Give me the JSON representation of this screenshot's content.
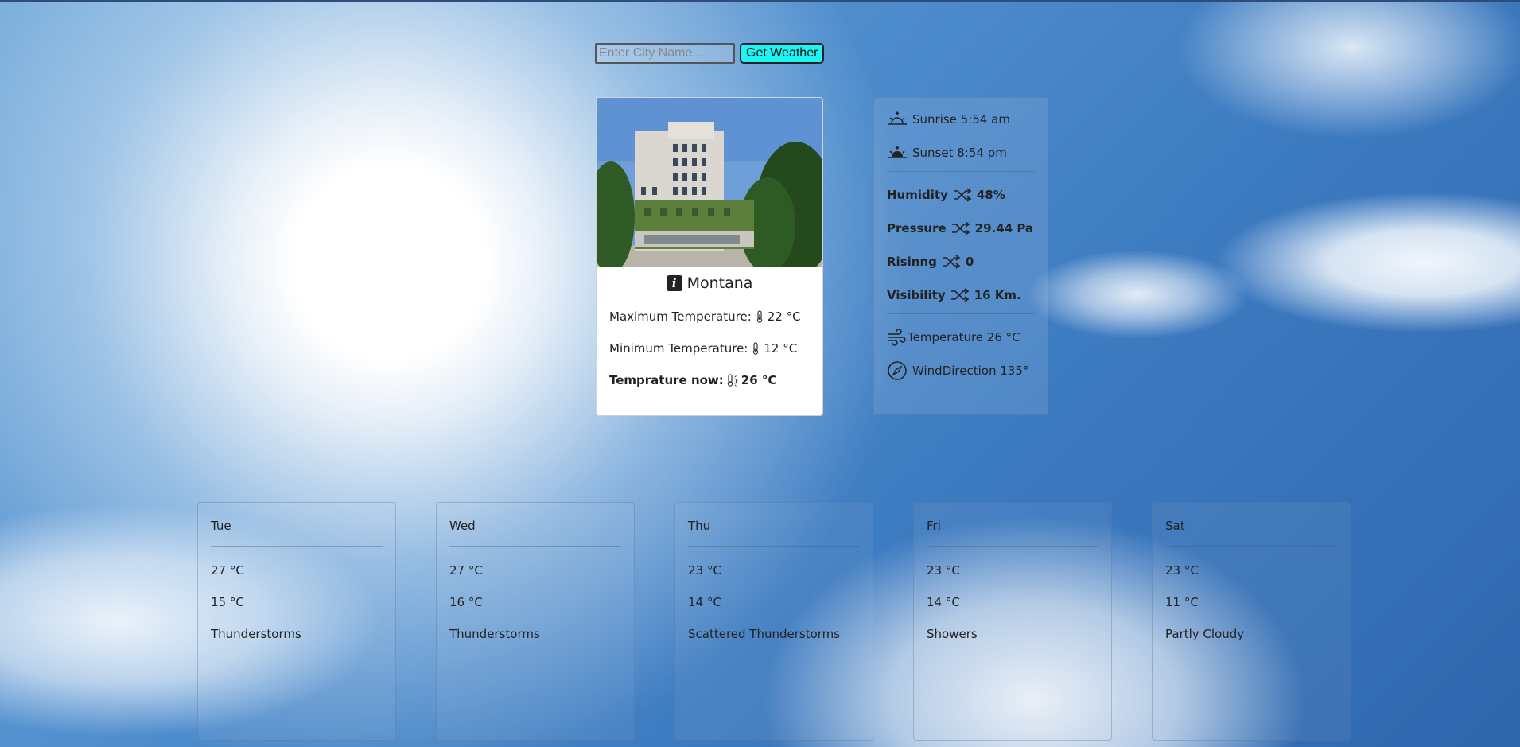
{
  "search": {
    "placeholder": "Enter City Name...",
    "button_label": "Get Weather"
  },
  "city": {
    "name": "Montana",
    "max_label": "Maximum Temperature:",
    "max_value": "22 °C",
    "min_label": "Minimum Temperature:",
    "min_value": "12 °C",
    "now_label": "Temprature now:",
    "now_value": "26 °C"
  },
  "details": {
    "sunrise": "Sunrise 5:54 am",
    "sunset": "Sunset 8:54 pm",
    "humidity_label": "Humidity",
    "humidity_value": "48%",
    "pressure_label": "Pressure",
    "pressure_value": "29.44 Pa",
    "rising_label": "Risinng",
    "rising_value": "0",
    "visibility_label": "Visibility",
    "visibility_value": "16 Km.",
    "wind_temp": "Temperature 26 °C",
    "wind_direction": "WindDirection 135°"
  },
  "forecast": [
    {
      "day": "Tue",
      "high": "27 °C",
      "low": "15 °C",
      "condition": "Thunderstorms"
    },
    {
      "day": "Wed",
      "high": "27 °C",
      "low": "16 °C",
      "condition": "Thunderstorms"
    },
    {
      "day": "Thu",
      "high": "23 °C",
      "low": "14 °C",
      "condition": "Scattered Thunderstorms"
    },
    {
      "day": "Fri",
      "high": "23 °C",
      "low": "14 °C",
      "condition": "Showers"
    },
    {
      "day": "Sat",
      "high": "23 °C",
      "low": "11 °C",
      "condition": "Partly Cloudy"
    }
  ],
  "colors": {
    "button_bg": "#1ef4f4",
    "sky_blue": "#3c7ac0"
  }
}
